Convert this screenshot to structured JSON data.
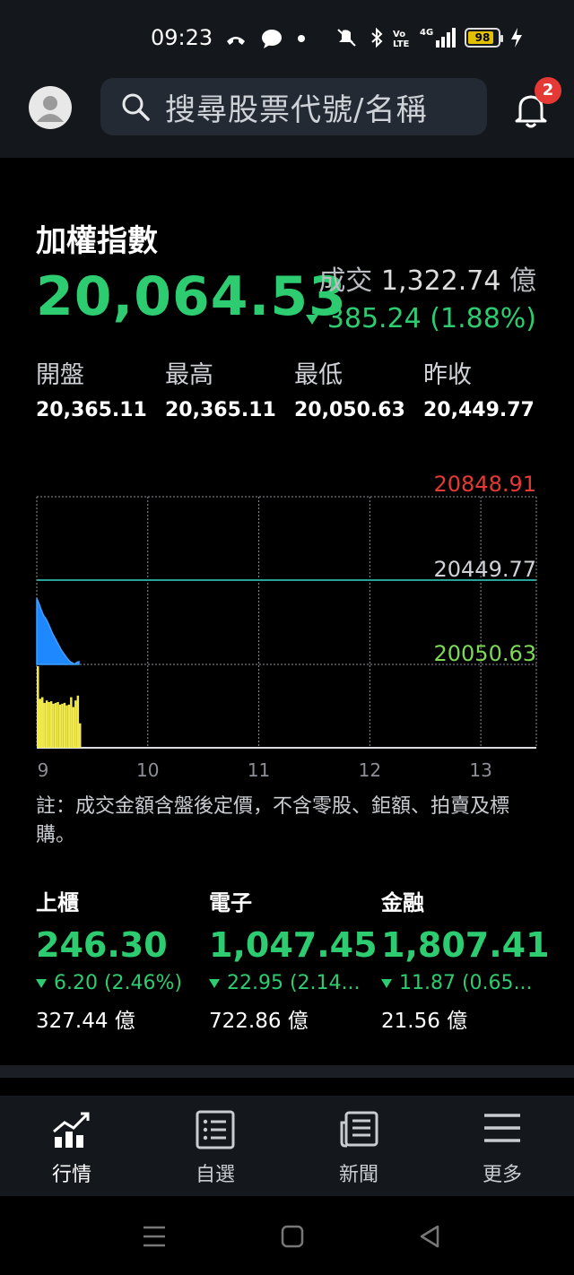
{
  "status_bar": {
    "time": "09:23",
    "battery": "98",
    "network": "4G"
  },
  "header": {
    "search_placeholder": "搜尋股票代號/名稱",
    "notification_count": "2"
  },
  "index": {
    "name": "加權指數",
    "value": "20,064.53",
    "volume_label": "成交",
    "volume_value": "1,322.74",
    "volume_unit": "億",
    "change": "385.24 (1.88%)",
    "direction": "down",
    "stats": [
      {
        "label": "開盤",
        "value": "20,365.11"
      },
      {
        "label": "最高",
        "value": "20,365.11"
      },
      {
        "label": "最低",
        "value": "20,050.63"
      },
      {
        "label": "昨收",
        "value": "20,449.77"
      }
    ]
  },
  "chart_data": {
    "type": "area",
    "price_upper": "20848.91",
    "price_ref": "20449.77",
    "price_lower": "20050.63",
    "ylim": [
      20050.63,
      20848.91
    ],
    "reference": 20449.77,
    "x_ticks": [
      "9",
      "10",
      "11",
      "12",
      "13"
    ],
    "x_range_hours": [
      9,
      13.5
    ],
    "price_series": [
      {
        "t": 9.0,
        "v": 20365
      },
      {
        "t": 9.02,
        "v": 20340
      },
      {
        "t": 9.04,
        "v": 20310
      },
      {
        "t": 9.06,
        "v": 20285
      },
      {
        "t": 9.08,
        "v": 20270
      },
      {
        "t": 9.1,
        "v": 20250
      },
      {
        "t": 9.12,
        "v": 20225
      },
      {
        "t": 9.14,
        "v": 20200
      },
      {
        "t": 9.16,
        "v": 20180
      },
      {
        "t": 9.18,
        "v": 20160
      },
      {
        "t": 9.2,
        "v": 20140
      },
      {
        "t": 9.22,
        "v": 20120
      },
      {
        "t": 9.24,
        "v": 20105
      },
      {
        "t": 9.26,
        "v": 20090
      },
      {
        "t": 9.28,
        "v": 20075
      },
      {
        "t": 9.3,
        "v": 20064
      },
      {
        "t": 9.32,
        "v": 20058
      },
      {
        "t": 9.34,
        "v": 20052
      },
      {
        "t": 9.36,
        "v": 20060
      },
      {
        "t": 9.38,
        "v": 20064
      }
    ],
    "volume_series": [
      {
        "t": 9.0,
        "v": 1.0
      },
      {
        "t": 9.02,
        "v": 0.6
      },
      {
        "t": 9.04,
        "v": 0.62
      },
      {
        "t": 9.06,
        "v": 0.55
      },
      {
        "t": 9.08,
        "v": 0.58
      },
      {
        "t": 9.1,
        "v": 0.56
      },
      {
        "t": 9.12,
        "v": 0.57
      },
      {
        "t": 9.14,
        "v": 0.54
      },
      {
        "t": 9.16,
        "v": 0.55
      },
      {
        "t": 9.18,
        "v": 0.56
      },
      {
        "t": 9.2,
        "v": 0.53
      },
      {
        "t": 9.22,
        "v": 0.54
      },
      {
        "t": 9.24,
        "v": 0.55
      },
      {
        "t": 9.26,
        "v": 0.52
      },
      {
        "t": 9.28,
        "v": 0.53
      },
      {
        "t": 9.3,
        "v": 0.62
      },
      {
        "t": 9.32,
        "v": 0.5
      },
      {
        "t": 9.34,
        "v": 0.58
      },
      {
        "t": 9.36,
        "v": 0.64
      },
      {
        "t": 9.38,
        "v": 0.3
      }
    ],
    "colors": {
      "upper": "#e53935",
      "ref": "#cfd3d8",
      "lower": "#7ed957",
      "price_fill": "#1e88ff",
      "volume_fill": "#f2ea4a",
      "grid": "#8c9096",
      "ref_line": "#2aa198"
    }
  },
  "note": "註：成交金額含盤後定價，不含零股、鉅額、拍賣及標購。",
  "markets": [
    {
      "name": "上櫃",
      "value": "246.30",
      "change": "6.20 (2.46%)",
      "volume": "327.44 億"
    },
    {
      "name": "電子",
      "value": "1,047.45",
      "change": "22.95 (2.14...",
      "volume": "722.86 億"
    },
    {
      "name": "金融",
      "value": "1,807.41",
      "change": "11.87 (0.65...",
      "volume": "21.56 億"
    }
  ],
  "bottom_nav": [
    {
      "label": "行情",
      "icon": "chart-icon",
      "active": true
    },
    {
      "label": "自選",
      "icon": "list-icon",
      "active": false
    },
    {
      "label": "新聞",
      "icon": "news-icon",
      "active": false
    },
    {
      "label": "更多",
      "icon": "menu-icon",
      "active": false
    }
  ]
}
